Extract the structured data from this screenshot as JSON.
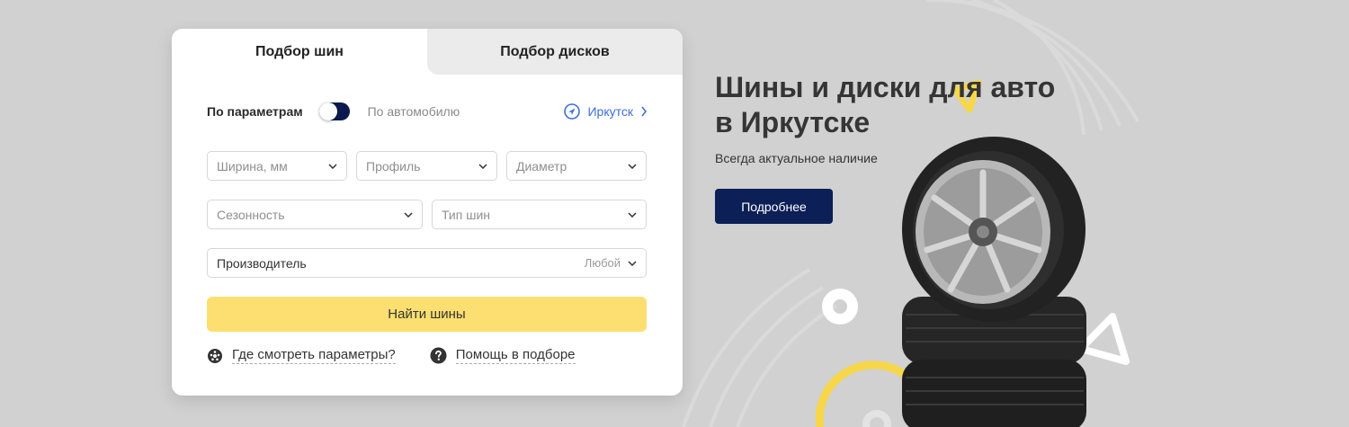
{
  "tabs": {
    "tires": "Подбор шин",
    "wheels": "Подбор дисков"
  },
  "mode": {
    "by_params": "По параметрам",
    "by_car": "По автомобилю",
    "city": "Иркутск"
  },
  "filters": {
    "width": "Ширина, мм",
    "profile": "Профиль",
    "diameter": "Диаметр",
    "season": "Сезонность",
    "type": "Тип шин",
    "manufacturer": "Производитель",
    "manufacturer_value": "Любой"
  },
  "find_button": "Найти шины",
  "help": {
    "where_params": "Где смотреть параметры?",
    "help_select": "Помощь в подборе"
  },
  "hero": {
    "title_line1": "Шины и диски для авто",
    "title_line2": "в Иркутске",
    "subtitle": "Всегда актуальное наличие",
    "button": "Подробнее"
  },
  "colors": {
    "background": "#d1d1d1",
    "accent_yellow": "#fcdf70",
    "navy": "#0c1f56",
    "link_blue": "#3b6fd6"
  }
}
